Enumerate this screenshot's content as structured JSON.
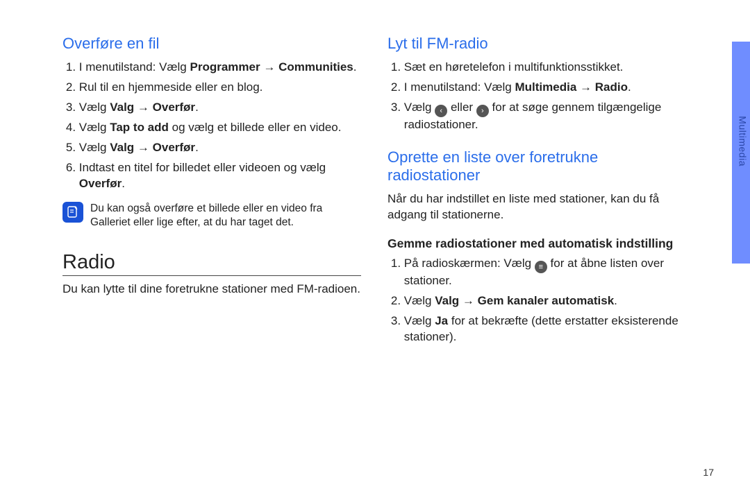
{
  "sideTab": "Multimedia",
  "pageNumber": "17",
  "left": {
    "section1": {
      "title": "Overføre en fil",
      "steps": [
        {
          "pre": "I menutilstand: Vælg ",
          "b1": "Programmer",
          "mid": " → ",
          "b2": "Communities",
          "post": "."
        },
        {
          "text": "Rul til en hjemmeside eller en blog."
        },
        {
          "pre": "Vælg ",
          "b1": "Valg",
          "mid": " → ",
          "b2": "Overfør",
          "post": "."
        },
        {
          "pre": "Vælg ",
          "b1": "Tap to add",
          "post": " og vælg et billede eller en video."
        },
        {
          "pre": "Vælg ",
          "b1": "Valg",
          "mid": " → ",
          "b2": "Overfør",
          "post": "."
        },
        {
          "pre": "Indtast en titel for billedet eller videoen og vælg ",
          "b1": "Overfør",
          "post": "."
        }
      ],
      "note": "Du kan også overføre et billede eller en video fra Galleriet eller lige efter, at du har taget det."
    },
    "section2": {
      "title": "Radio",
      "intro": "Du kan lytte til dine foretrukne stationer med FM-radioen."
    }
  },
  "right": {
    "section1": {
      "title": "Lyt til FM-radio",
      "steps": [
        {
          "text": "Sæt en høretelefon i multifunktionsstikket."
        },
        {
          "pre": "I menutilstand: Vælg ",
          "b1": "Multimedia",
          "mid": " → ",
          "b2": "Radio",
          "post": "."
        },
        {
          "pre": "Vælg ",
          "icon1": "prev-icon",
          "mid1": " eller ",
          "icon2": "next-icon",
          "post": " for at søge gennem tilgængelige radiostationer."
        }
      ]
    },
    "section2": {
      "title": "Oprette en liste over foretrukne radiostationer",
      "intro": "Når du har indstillet en liste med stationer, kan du få adgang til stationerne.",
      "subhead": "Gemme radiostationer med automatisk indstilling",
      "steps": [
        {
          "pre": "På radioskærmen: Vælg ",
          "icon1": "list-icon",
          "post": " for at åbne listen over stationer."
        },
        {
          "pre": "Vælg ",
          "b1": "Valg",
          "mid": " → ",
          "b2": "Gem kanaler automatisk",
          "post": "."
        },
        {
          "pre": "Vælg ",
          "b1": "Ja",
          "post": " for at bekræfte (dette erstatter eksisterende stationer)."
        }
      ]
    }
  },
  "glyphs": {
    "prev": "‹",
    "next": "›",
    "list": "≡"
  }
}
